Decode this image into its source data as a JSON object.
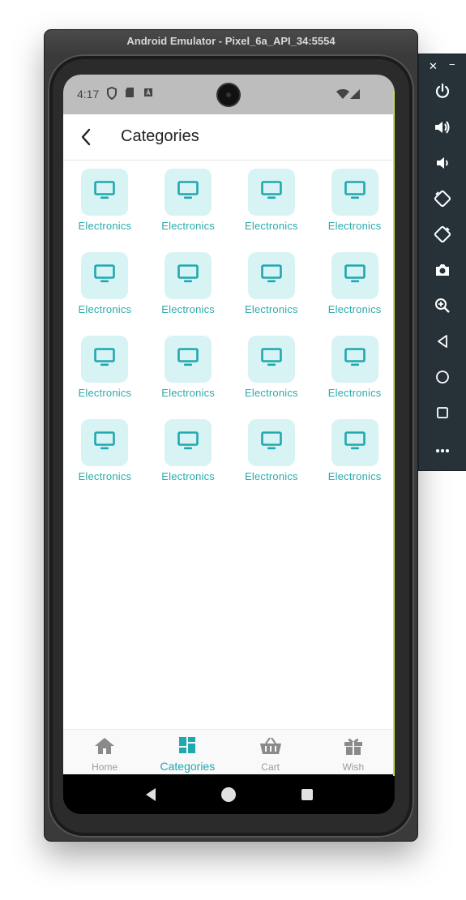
{
  "window": {
    "title": "Android Emulator - Pixel_6a_API_34:5554"
  },
  "status_bar": {
    "time": "4:17"
  },
  "app_bar": {
    "title": "Categories"
  },
  "colors": {
    "accent": "#1fa8b0",
    "tile_bg": "#d8f3f3",
    "toolbar_bg": "#263238"
  },
  "categories": [
    {
      "label": "Electronics",
      "icon": "monitor-icon"
    },
    {
      "label": "Electronics",
      "icon": "monitor-icon"
    },
    {
      "label": "Electronics",
      "icon": "monitor-icon"
    },
    {
      "label": "Electronics",
      "icon": "monitor-icon"
    },
    {
      "label": "Electronics",
      "icon": "monitor-icon"
    },
    {
      "label": "Electronics",
      "icon": "monitor-icon"
    },
    {
      "label": "Electronics",
      "icon": "monitor-icon"
    },
    {
      "label": "Electronics",
      "icon": "monitor-icon"
    },
    {
      "label": "Electronics",
      "icon": "monitor-icon"
    },
    {
      "label": "Electronics",
      "icon": "monitor-icon"
    },
    {
      "label": "Electronics",
      "icon": "monitor-icon"
    },
    {
      "label": "Electronics",
      "icon": "monitor-icon"
    },
    {
      "label": "Electronics",
      "icon": "monitor-icon"
    },
    {
      "label": "Electronics",
      "icon": "monitor-icon"
    },
    {
      "label": "Electronics",
      "icon": "monitor-icon"
    },
    {
      "label": "Electronics",
      "icon": "monitor-icon"
    }
  ],
  "bottom_nav": [
    {
      "label": "Home",
      "icon": "home-icon",
      "active": false
    },
    {
      "label": "Categories",
      "icon": "dashboard-icon",
      "active": true
    },
    {
      "label": "Cart",
      "icon": "basket-icon",
      "active": false
    },
    {
      "label": "Wish",
      "icon": "gift-icon",
      "active": false
    }
  ],
  "emulator_toolbar": [
    "power-icon",
    "volume-up-icon",
    "volume-down-icon",
    "rotate-left-icon",
    "rotate-right-icon",
    "camera-icon",
    "zoom-icon",
    "back-icon",
    "home-icon",
    "overview-icon",
    "more-icon"
  ]
}
